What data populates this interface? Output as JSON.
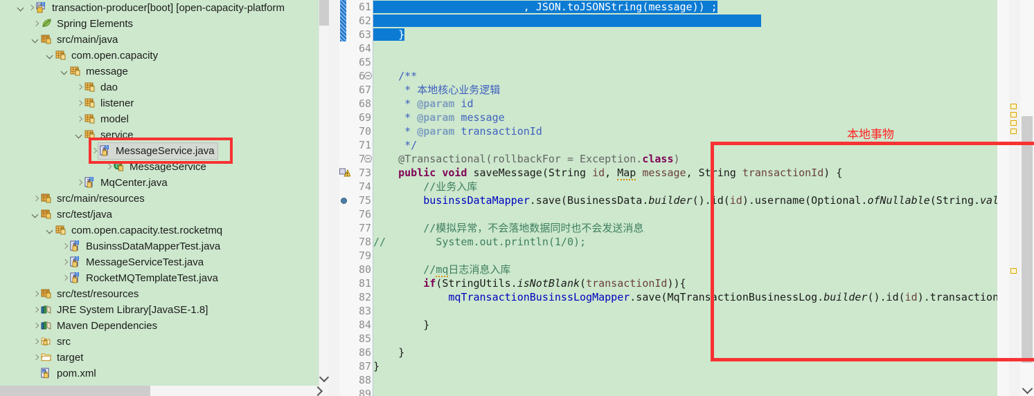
{
  "explorer": {
    "name": "package-explorer-tree",
    "rows": [
      {
        "indent": 0,
        "twisty": "expanded",
        "icon": "java-project-icon",
        "label": "transaction-producer",
        "dim": " [boot] [open-capacity-platform",
        "extra_chevron": true
      },
      {
        "indent": 1,
        "twisty": "collapsed",
        "icon": "spring-leaf-icon",
        "label": "Spring Elements",
        "dim": ""
      },
      {
        "indent": 1,
        "twisty": "expanded",
        "icon": "source-folder-icon",
        "label": "src/main/java",
        "dim": ""
      },
      {
        "indent": 2,
        "twisty": "expanded",
        "icon": "package-icon",
        "label": "com.open.capacity",
        "dim": ""
      },
      {
        "indent": 3,
        "twisty": "expanded",
        "icon": "package-icon",
        "label": "message",
        "dim": ""
      },
      {
        "indent": 4,
        "twisty": "collapsed",
        "icon": "package-icon",
        "label": "dao",
        "dim": ""
      },
      {
        "indent": 4,
        "twisty": "collapsed",
        "icon": "package-icon",
        "label": "listener",
        "dim": ""
      },
      {
        "indent": 4,
        "twisty": "collapsed",
        "icon": "package-icon",
        "label": "model",
        "dim": ""
      },
      {
        "indent": 4,
        "twisty": "expanded",
        "icon": "package-icon",
        "label": "service",
        "dim": ""
      },
      {
        "indent": 5,
        "twisty": "collapsed",
        "icon": "java-file-icon",
        "label": "MessageService.java",
        "dim": "",
        "selected": true
      },
      {
        "indent": 6,
        "twisty": "collapsed",
        "icon": "java-class-icon",
        "label": "MessageService",
        "dim": ""
      },
      {
        "indent": 4,
        "twisty": "collapsed",
        "icon": "java-file-icon",
        "label": "MqCenter.java",
        "dim": ""
      },
      {
        "indent": 1,
        "twisty": "collapsed",
        "icon": "source-folder-icon",
        "label": "src/main/resources",
        "dim": ""
      },
      {
        "indent": 1,
        "twisty": "expanded",
        "icon": "source-folder-icon",
        "label": "src/test/java",
        "dim": ""
      },
      {
        "indent": 2,
        "twisty": "expanded",
        "icon": "package-icon",
        "label": "com.open.capacity.test.rocketmq",
        "dim": ""
      },
      {
        "indent": 3,
        "twisty": "collapsed",
        "icon": "java-file-icon",
        "label": "BusinssDataMapperTest.java",
        "dim": ""
      },
      {
        "indent": 3,
        "twisty": "collapsed",
        "icon": "java-file-icon",
        "label": "MessageServiceTest.java",
        "dim": ""
      },
      {
        "indent": 3,
        "twisty": "collapsed",
        "icon": "java-file-icon",
        "label": "RocketMQTemplateTest.java",
        "dim": ""
      },
      {
        "indent": 1,
        "twisty": "collapsed",
        "icon": "source-folder-icon",
        "label": "src/test/resources",
        "dim": ""
      },
      {
        "indent": 1,
        "twisty": "collapsed",
        "icon": "library-icon",
        "label": "JRE System Library",
        "dim": " [JavaSE-1.8]"
      },
      {
        "indent": 1,
        "twisty": "collapsed",
        "icon": "library-icon",
        "label": "Maven Dependencies",
        "dim": ""
      },
      {
        "indent": 1,
        "twisty": "collapsed",
        "icon": "plain-folder-icon",
        "label": "src",
        "dim": ""
      },
      {
        "indent": 1,
        "twisty": "collapsed",
        "icon": "target-folder-icon",
        "label": "target",
        "dim": ""
      },
      {
        "indent": 1,
        "twisty": "none",
        "icon": "xml-file-icon",
        "label": "pom.xml",
        "dim": ""
      }
    ]
  },
  "editor": {
    "name": "java-code-editor",
    "first_line": 61,
    "line_numbers": [
      61,
      62,
      63,
      64,
      65,
      66,
      67,
      68,
      69,
      70,
      71,
      72,
      73,
      74,
      75,
      76,
      77,
      78,
      79,
      80,
      81,
      82,
      83,
      84,
      85,
      86,
      87,
      88,
      89
    ],
    "folding_lines": [
      66,
      72
    ],
    "warning_lines": [
      73
    ],
    "breakpoint_lines": [
      75
    ],
    "annotation_text": "本地事物",
    "lines": [
      {
        "n": 61,
        "text": "                        , JSON.toJSONString(message)) ;",
        "selected": true
      },
      {
        "n": 62,
        "text": "",
        "selected": true
      },
      {
        "n": 63,
        "text": "    }",
        "selected": true
      },
      {
        "n": 64,
        "text": ""
      },
      {
        "n": 65,
        "text": ""
      },
      {
        "n": 66,
        "text": "    /**"
      },
      {
        "n": 67,
        "text": "     * 本地核心业务逻辑"
      },
      {
        "n": 68,
        "text": "     * @param id"
      },
      {
        "n": 69,
        "text": "     * @param message"
      },
      {
        "n": 70,
        "text": "     * @param transactionId"
      },
      {
        "n": 71,
        "text": "     */"
      },
      {
        "n": 72,
        "text": "    @Transactional(rollbackFor = Exception.class)"
      },
      {
        "n": 73,
        "text": "    public void saveMessage(String id, Map message, String transactionId) {"
      },
      {
        "n": 74,
        "text": "        //业务入库"
      },
      {
        "n": 75,
        "text": "        businssDataMapper.save(BusinessData.builder().id(id).username(Optional.ofNullable(String.valueO"
      },
      {
        "n": 76,
        "text": ""
      },
      {
        "n": 77,
        "text": "        //模拟异常，不会落地数据同时也不会发送消息"
      },
      {
        "n": 78,
        "text": "//        System.out.println(1/0);"
      },
      {
        "n": 79,
        "text": ""
      },
      {
        "n": 80,
        "text": "        //mq日志消息入库"
      },
      {
        "n": 81,
        "text": "        if(StringUtils.isNotBlank(transactionId)){"
      },
      {
        "n": 82,
        "text": "            mqTransactionBusinssLogMapper.save(MqTransactionBusinessLog.builder().id(id).transactionId"
      },
      {
        "n": 83,
        "text": ""
      },
      {
        "n": 84,
        "text": "        }"
      },
      {
        "n": 85,
        "text": ""
      },
      {
        "n": 86,
        "text": "    }"
      },
      {
        "n": 87,
        "text": "}"
      },
      {
        "n": 88,
        "text": ""
      },
      {
        "n": 89,
        "text": ""
      }
    ]
  },
  "colors": {
    "editor_background": "#cde8cd",
    "tree_background": "#cde8cd",
    "selection_blue": "#0c7bd4",
    "annotation_red": "#f73232",
    "keyword_purple": "#7f0055",
    "comment_green": "#3f7f5f",
    "javadoc_blue": "#3f5fbf",
    "field_blue": "#0000c0",
    "scrollbar_thumb": "#cdcdcd"
  },
  "scrollbars": {
    "tree_vertical": "tree-vertical-scrollbar",
    "tree_horizontal": "tree-horizontal-scrollbar",
    "editor_vertical": "editor-vertical-scrollbar",
    "editor_overview_ruler": "editor-overview-ruler"
  }
}
